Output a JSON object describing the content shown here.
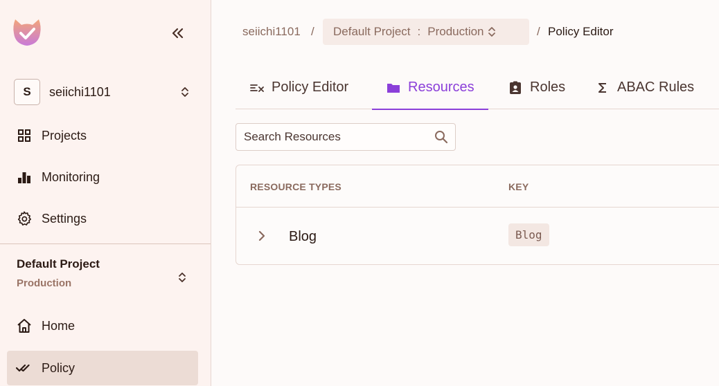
{
  "sidebar": {
    "logo_icon": "app-logo-checkmark",
    "collapse_icon": "double-chevron-left-icon",
    "org": {
      "initial": "S",
      "name": "seiichi1101"
    },
    "nav_top": [
      {
        "label": "Projects",
        "icon": "grid-icon"
      },
      {
        "label": "Monitoring",
        "icon": "bar-chart-icon"
      },
      {
        "label": "Settings",
        "icon": "gear-icon"
      }
    ],
    "project": {
      "name": "Default Project",
      "env": "Production"
    },
    "nav_bottom": [
      {
        "label": "Home",
        "icon": "home-icon"
      },
      {
        "label": "Policy",
        "icon": "double-check-icon",
        "active": true
      }
    ]
  },
  "breadcrumb": {
    "org": "seiichi1101",
    "sep": "/",
    "project": "Default Project",
    "colon": ":",
    "env": "Production",
    "page": "Policy Editor"
  },
  "tabs": [
    {
      "label": "Policy Editor",
      "icon": "list-check-icon"
    },
    {
      "label": "Resources",
      "icon": "folder-icon",
      "active": true
    },
    {
      "label": "Roles",
      "icon": "id-badge-icon"
    },
    {
      "label": "ABAC Rules",
      "icon": "sigma-icon"
    }
  ],
  "search": {
    "placeholder": "Search Resources",
    "value": ""
  },
  "table": {
    "columns": [
      "RESOURCE TYPES",
      "KEY"
    ],
    "rows": [
      {
        "name": "Blog",
        "key": "Blog"
      }
    ]
  },
  "colors": {
    "accent": "#8b3fd9",
    "sidebar_bg": "#fdf3f0",
    "active_nav_bg": "#ecdcd5"
  }
}
